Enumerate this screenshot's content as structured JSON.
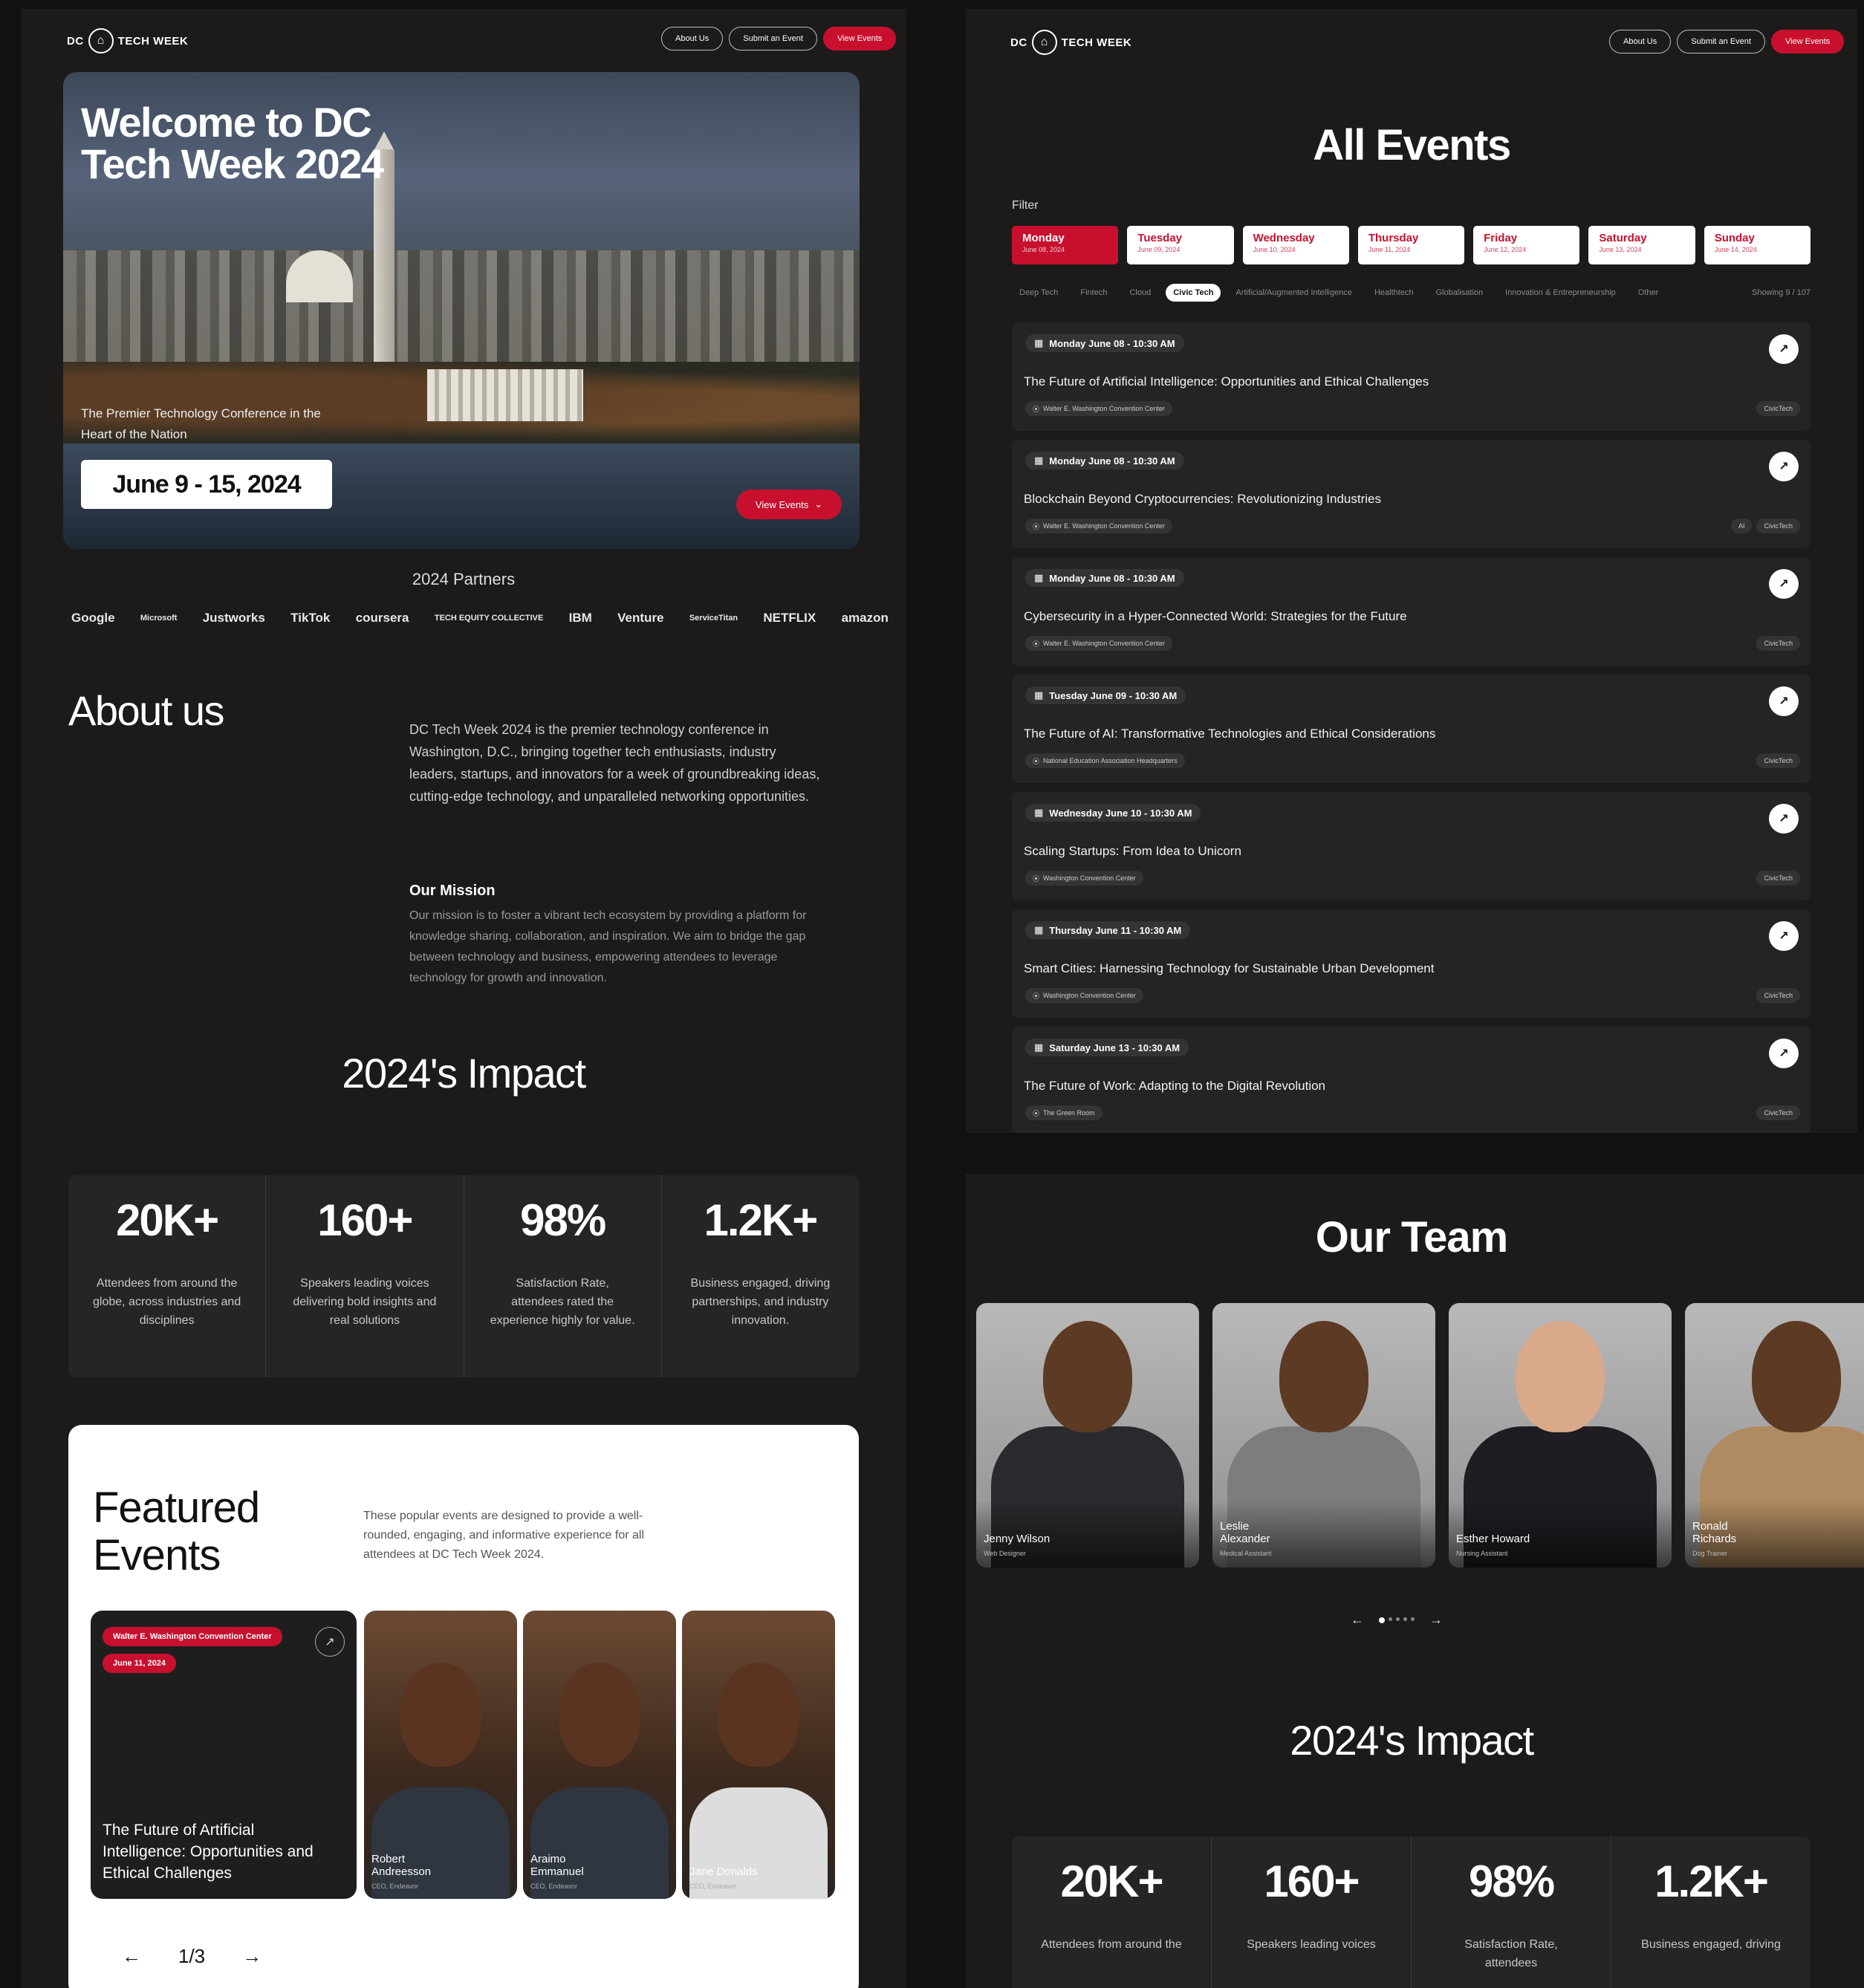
{
  "brand": {
    "logo_left": "DC",
    "logo_right": "TECH WEEK"
  },
  "nav": {
    "about": "About Us",
    "submit": "Submit an Event",
    "view": "View Events"
  },
  "hero": {
    "title": "Welcome to DC Tech Week 2024",
    "subtitle": "The Premier Technology Conference in the Heart of the Nation",
    "dates": "June 9 - 15, 2024",
    "button": "View Events"
  },
  "partners": {
    "title": "2024 Partners",
    "logos": [
      "Google",
      "Microsoft",
      "Justworks",
      "TikTok",
      "coursera",
      "TECH EQUITY COLLECTIVE",
      "IBM",
      "Venture",
      "ServiceTitan",
      "NETFLIX",
      "amazon"
    ]
  },
  "about": {
    "title": "About us",
    "text": "DC Tech Week 2024 is the premier technology conference in Washington, D.C., bringing together tech enthusiasts, industry leaders, startups, and innovators for a week of groundbreaking ideas, cutting-edge technology, and unparalleled networking opportunities.",
    "mission_title": "Our Mission",
    "mission_text": "Our mission is to foster a vibrant tech ecosystem by providing a platform for knowledge sharing, collaboration, and inspiration. We aim to bridge the gap between technology and business, empowering attendees to leverage technology for growth and innovation."
  },
  "impact": {
    "title": "2024's Impact",
    "stats": [
      {
        "num": "20K+",
        "desc": "Attendees from around the globe, across industries and disciplines"
      },
      {
        "num": "160+",
        "desc": "Speakers leading voices delivering bold insights and real solutions"
      },
      {
        "num": "98%",
        "desc": "Satisfaction Rate, attendees rated the experience highly for value."
      },
      {
        "num": "1.2K+",
        "desc": "Business engaged, driving partnerships, and industry innovation."
      }
    ]
  },
  "featured": {
    "title": "Featured Events",
    "desc": "These popular events are designed to provide a well-rounded, engaging, and informative experience for all attendees at DC Tech Week 2024.",
    "card": {
      "location": "Walter E. Washington Convention Center",
      "date": "June 11, 2024",
      "title": "The Future of Artificial Intelligence: Opportunities and Ethical Challenges"
    },
    "speakers": [
      {
        "name": "Robert Andreesson",
        "role": "CEO, Endeavor"
      },
      {
        "name": "Araimo Emmanuel",
        "role": "CEO, Endeavor"
      },
      {
        "name": "Jane Donalds",
        "role": "CEO, Endeavor"
      }
    ],
    "pager": "1/3",
    "prev": "←",
    "next": "→"
  },
  "events": {
    "title": "All Events",
    "filter_label": "Filter",
    "days": [
      {
        "name": "Monday",
        "date": "June 08, 2024"
      },
      {
        "name": "Tuesday",
        "date": "June 09, 2024"
      },
      {
        "name": "Wednesday",
        "date": "June 10, 2024"
      },
      {
        "name": "Thursday",
        "date": "June 11, 2024"
      },
      {
        "name": "Friday",
        "date": "June 12, 2024"
      },
      {
        "name": "Saturday",
        "date": "June 13, 2024"
      },
      {
        "name": "Sunday",
        "date": "June 14, 2024"
      }
    ],
    "categories": [
      "Deep Tech",
      "Fintech",
      "Cloud",
      "Civic Tech",
      "Artificial/Augmented Intelligence",
      "Healthtech",
      "Globalisation",
      "Innovation & Entrepreneurship",
      "Other"
    ],
    "showing": "Showing 9 / 107",
    "list": [
      {
        "date": "Monday June 08 - 10:30 AM",
        "title": "The Future of Artificial Intelligence: Opportunities and Ethical Challenges",
        "location": "Walter E. Washington Convention Center",
        "tags": [
          "CivicTech"
        ]
      },
      {
        "date": "Monday June 08 - 10:30 AM",
        "title": "Blockchain Beyond Cryptocurrencies: Revolutionizing Industries",
        "location": "Walter E. Washington Convention Center",
        "tags": [
          "AI",
          "CivicTech"
        ]
      },
      {
        "date": "Monday June 08 - 10:30 AM",
        "title": "Cybersecurity in a Hyper-Connected World: Strategies for the Future",
        "location": "Walter E. Washington Convention Center",
        "tags": [
          "CivicTech"
        ]
      },
      {
        "date": "Tuesday June 09 - 10:30 AM",
        "title": "The Future of AI: Transformative Technologies and Ethical Considerations",
        "location": "National Education Association Headquarters",
        "tags": [
          "CivicTech"
        ]
      },
      {
        "date": "Wednesday June 10 - 10:30 AM",
        "title": "Scaling Startups: From Idea to Unicorn",
        "location": "Washington Convention Center",
        "tags": [
          "CivicTech"
        ]
      },
      {
        "date": "Thursday June 11 - 10:30 AM",
        "title": "Smart Cities: Harnessing Technology for Sustainable Urban Development",
        "location": "Washington Convention Center",
        "tags": [
          "CivicTech"
        ]
      },
      {
        "date": "Saturday June 13 - 10:30 AM",
        "title": "The Future of Work: Adapting to the Digital Revolution",
        "location": "The Green Room",
        "tags": [
          "CivicTech"
        ]
      }
    ]
  },
  "team": {
    "title": "Our Team",
    "members": [
      {
        "name": "Jenny Wilson",
        "role": "Web Designer"
      },
      {
        "name": "Leslie Alexander",
        "role": "Medical Assistant"
      },
      {
        "name": "Esther Howard",
        "role": "Nursing Assistant"
      },
      {
        "name": "Ronald Richards",
        "role": "Dog Trainer"
      }
    ],
    "prev": "←",
    "next": "→"
  },
  "impact2": {
    "title": "2024's Impact",
    "stats": [
      {
        "num": "20K+",
        "desc": "Attendees from around the"
      },
      {
        "num": "160+",
        "desc": "Speakers leading voices"
      },
      {
        "num": "98%",
        "desc": "Satisfaction Rate, attendees"
      },
      {
        "num": "1.2K+",
        "desc": "Business engaged, driving"
      }
    ]
  },
  "colors": {
    "accent": "#c8102e",
    "background": "#1c1b1a",
    "card": "#252423"
  }
}
